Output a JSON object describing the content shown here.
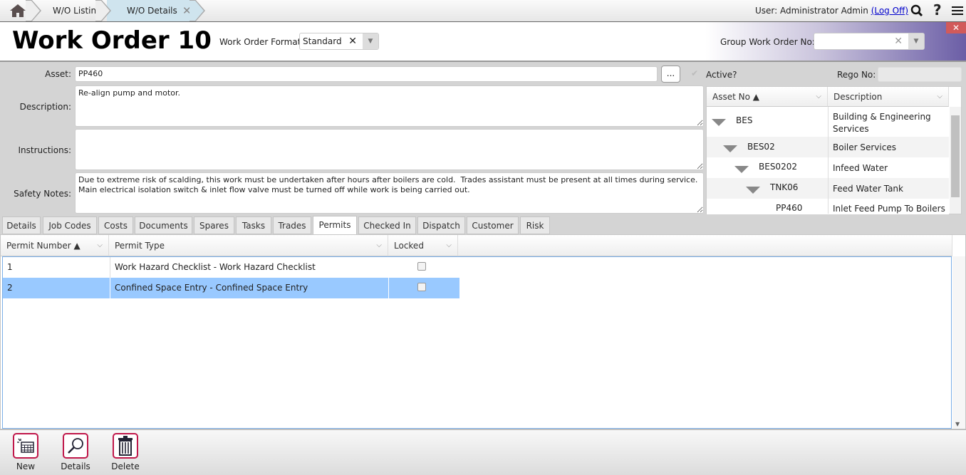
{
  "topbar": {
    "breadcrumbs": [
      {
        "label": "W/O Listing"
      },
      {
        "label": "W/O Details"
      }
    ],
    "user_text": "User: Administrator Admin",
    "logoff": "(Log Off)"
  },
  "header": {
    "title": "Work Order 10",
    "format_label": "Work Order Format",
    "format_value": "Standard",
    "group_label": "Group Work Order No:",
    "group_value": ""
  },
  "form": {
    "asset_label": "Asset:",
    "asset_value": "PP460",
    "browse": "...",
    "active_label": "Active?",
    "active_checked": true,
    "rego_label": "Rego No:",
    "rego_value": "",
    "description_label": "Description:",
    "description_value": "Re-align pump and motor.",
    "instructions_label": "Instructions:",
    "instructions_value": "",
    "safety_label": "Safety Notes:",
    "safety_value": "Due to extreme risk of scalding, this work must be undertaken after hours after boilers are cold.  Trades assistant must be present at all times during service.  Main electrical isolation switch & inlet flow valve must be turned off while work is being carried out."
  },
  "tree": {
    "columns": [
      "Asset No ▲",
      "Description"
    ],
    "rows": [
      {
        "asset": "BES",
        "description": "Building & Engineering Services"
      },
      {
        "asset": "BES02",
        "description": "Boiler Services"
      },
      {
        "asset": "BES0202",
        "description": "Infeed Water"
      },
      {
        "asset": "TNK06",
        "description": "Feed Water Tank"
      },
      {
        "asset": "PP460",
        "description": "Inlet Feed Pump To Boilers"
      }
    ]
  },
  "tabs": [
    "Details",
    "Job Codes",
    "Costs",
    "Documents",
    "Spares",
    "Tasks",
    "Trades",
    "Permits",
    "Checked In",
    "Dispatch",
    "Customer",
    "Risk"
  ],
  "active_tab": "Permits",
  "grid": {
    "columns": [
      "Permit Number ▲",
      "Permit Type",
      "Locked"
    ],
    "rows": [
      {
        "number": "1",
        "type": "Work Hazard Checklist - Work Hazard Checklist",
        "locked": false
      },
      {
        "number": "2",
        "type": "Confined Space Entry - Confined Space Entry",
        "locked": false,
        "selected": true
      }
    ]
  },
  "footer": {
    "new": "New",
    "details": "Details",
    "delete": "Delete"
  },
  "colors": {
    "accent": "#c0174a",
    "selected_row": "#99c9ff",
    "header_gradient": "#6b5ea6"
  }
}
